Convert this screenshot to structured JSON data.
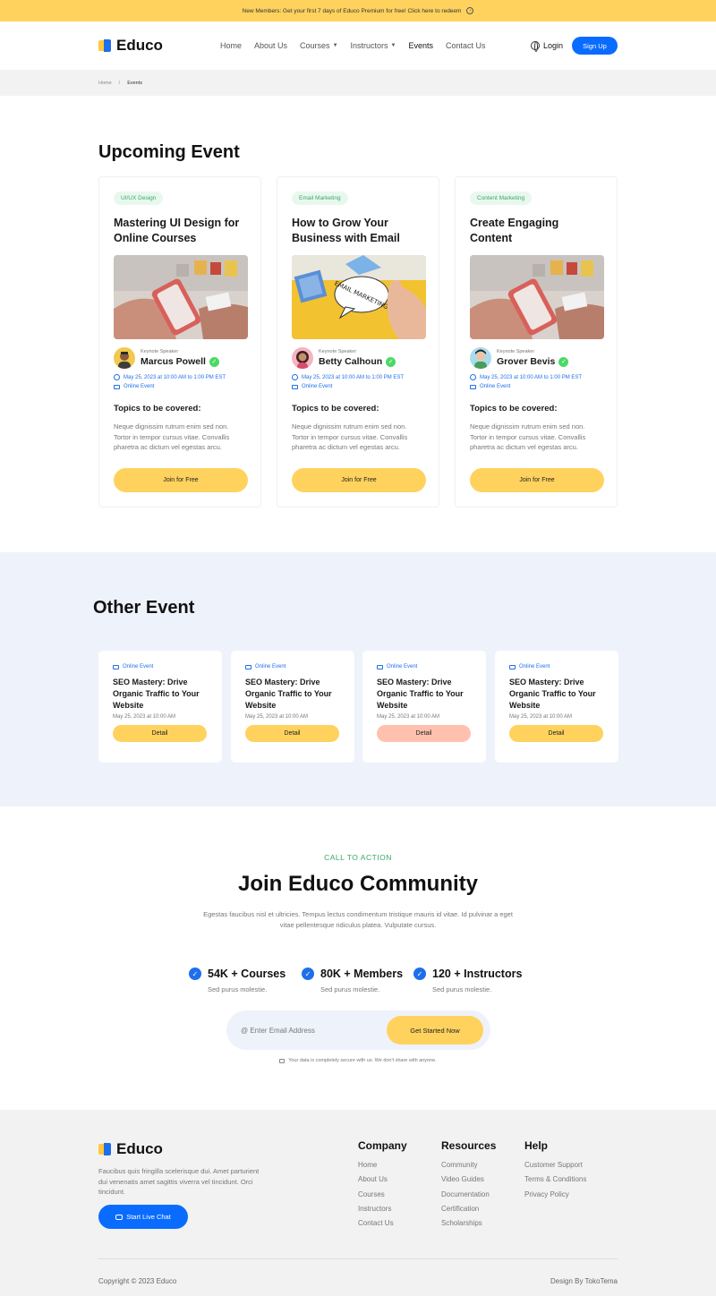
{
  "announcement": {
    "text": "New Members: Get your first 7 days of Educo Premium for free! Click here to redeem"
  },
  "brand": {
    "name": "Educo"
  },
  "nav": [
    {
      "label": "Home",
      "dropdown": false,
      "active": false
    },
    {
      "label": "About Us",
      "dropdown": false,
      "active": false
    },
    {
      "label": "Courses",
      "dropdown": true,
      "active": false
    },
    {
      "label": "Instructors",
      "dropdown": true,
      "active": false
    },
    {
      "label": "Events",
      "dropdown": false,
      "active": true
    },
    {
      "label": "Contact Us",
      "dropdown": false,
      "active": false
    }
  ],
  "header": {
    "login": "Login",
    "signup": "Sign Up"
  },
  "breadcrumb": {
    "home": "Home",
    "sep": "/",
    "current": "Events"
  },
  "upcoming": {
    "title": "Upcoming Event",
    "cards": [
      {
        "tag": "UI/UX Design",
        "title": "Mastering UI Design for Online Courses",
        "speaker_label": "Keynote Speaker",
        "speaker": "Marcus Powell",
        "datetime": "May 25, 2023 at 10:00 AM to 1:00 PM EST",
        "location": "Online Event",
        "topics_title": "Topics to be covered:",
        "topics_desc": "Neque dignissim rutrum enim sed non. Tortor in tempor cursus vitae. Convallis pharetra ac dictum vel egestas arcu.",
        "cta": "Join for Free"
      },
      {
        "tag": "Email Marketing",
        "title": "How to Grow Your Business with Email",
        "image_text": "EMAIL MARKETING",
        "speaker_label": "Keynote Speaker",
        "speaker": "Betty Calhoun",
        "datetime": "May 25, 2023 at 10:00 AM to 1:00 PM EST",
        "location": "Online Event",
        "topics_title": "Topics to be covered:",
        "topics_desc": "Neque dignissim rutrum enim sed non. Tortor in tempor cursus vitae. Convallis pharetra ac dictum vel egestas arcu.",
        "cta": "Join for Free"
      },
      {
        "tag": "Content Marketing",
        "title": "Create Engaging Content",
        "speaker_label": "Keynote Speaker",
        "speaker": "Grover Bevis",
        "datetime": "May 25, 2023 at 10:00 AM to 1:00 PM EST",
        "location": "Online Event",
        "topics_title": "Topics to be covered:",
        "topics_desc": "Neque dignissim rutrum enim sed non. Tortor in tempor cursus vitae. Convallis pharetra ac dictum vel egestas arcu.",
        "cta": "Join for Free"
      }
    ]
  },
  "other": {
    "title": "Other Event",
    "cards": [
      {
        "location": "Online Event",
        "title": "SEO Mastery: Drive Organic Traffic to Your Website",
        "date": "May 25, 2023 at 10:00 AM",
        "cta": "Detail"
      },
      {
        "location": "Online Event",
        "title": "SEO Mastery: Drive Organic Traffic to Your Website",
        "date": "May 25, 2023 at 10:00 AM",
        "cta": "Detail"
      },
      {
        "location": "Online Event",
        "title": "SEO Mastery: Drive Organic Traffic to Your Website",
        "date": "May 25, 2023 at 10:00 AM",
        "cta": "Detail"
      },
      {
        "location": "Online Event",
        "title": "SEO Mastery: Drive Organic Traffic to Your Website",
        "date": "May 25, 2023 at 10:00 AM",
        "cta": "Detail"
      }
    ]
  },
  "cta": {
    "eyebrow": "CALL TO ACTION",
    "title": "Join Educo Community",
    "desc": "Egestas faucibus nisl et ultricies. Tempus lectus condimentum tristique mauris id vitae. Id pulvinar a eget vitae pellentesque ridiculus platea. Vulputate cursus.",
    "stats": [
      {
        "value": "54K + Courses",
        "sub": "Sed purus molestie."
      },
      {
        "value": "80K + Members",
        "sub": "Sed purus molestie."
      },
      {
        "value": "120 + Instructors",
        "sub": "Sed purus molestie."
      }
    ],
    "email_placeholder": "@ Enter Email Address",
    "button": "Get Started Now",
    "secure": "Your data is completely secure with us. We don't share with anyone."
  },
  "footer": {
    "brand": "Educo",
    "desc": "Faucibus quis fringilla scelerisque dui. Amet parturient dui venenatis amet sagittis viverra vel tincidunt. Orci tincidunt.",
    "live_chat": "Start Live Chat",
    "columns": [
      {
        "title": "Company",
        "items": [
          "Home",
          "About Us",
          "Courses",
          "Instructors",
          "Contact Us"
        ]
      },
      {
        "title": "Resources",
        "items": [
          "Community",
          "Video Guides",
          "Documentation",
          "Certification",
          "Scholarships"
        ]
      },
      {
        "title": "Help",
        "items": [
          "Customer Support",
          "Terms & Conditions",
          "Privacy Policy"
        ]
      }
    ],
    "copyright": "Copyright © 2023 Educo",
    "credit": "Design By TokoTema"
  },
  "colors": {
    "accent_yellow": "#FFD25E",
    "primary_blue": "#0A6CFF",
    "tag_green": "#37A86A",
    "section_bg": "#EEF2FB"
  }
}
